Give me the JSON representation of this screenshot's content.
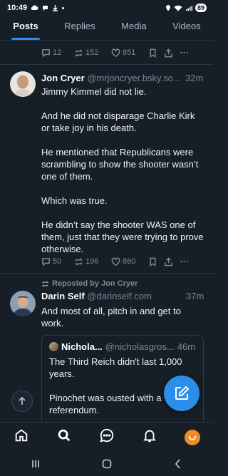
{
  "status_bar": {
    "time": "10:49",
    "battery": "89"
  },
  "tabs": [
    {
      "label": "Posts",
      "active": true
    },
    {
      "label": "Replies",
      "active": false
    },
    {
      "label": "Media",
      "active": false
    },
    {
      "label": "Videos",
      "active": false
    }
  ],
  "top_actions": {
    "replies": "12",
    "reposts": "152",
    "likes": "851"
  },
  "post1": {
    "author": "Jon Cryer",
    "handle": "@mrjoncryer.bsky.so...",
    "time": "32m",
    "paragraphs": [
      "Jimmy Kimmel did not lie.",
      "And he did not disparage Charlie Kirk or take joy in his death.",
      "He mentioned that Republicans were scrambling to show the shooter wasn’t one of them.",
      "Which was true.",
      "He didn’t say the shooter WAS one of them, just that they were trying to prove otherwise."
    ],
    "actions": {
      "replies": "50",
      "reposts": "196",
      "likes": "860"
    }
  },
  "post2": {
    "repost_label": "Reposted by Jon Cryer",
    "author": "Darin Self",
    "handle": "@darinself.com",
    "time": "37m",
    "text": "And most of all, pitch in and get to work.",
    "quote": {
      "author": "Nichola...",
      "handle": "@nicholasgros...",
      "time": "46m",
      "paragraphs": [
        "The Third Reich didn't last 1,000 years.",
        "Pinochet was ousted with a referendum."
      ]
    }
  },
  "colors": {
    "background": "#161e27",
    "accent": "#2c8ee8",
    "muted": "#7b8998"
  }
}
